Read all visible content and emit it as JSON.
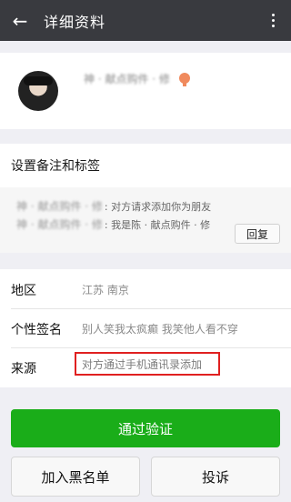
{
  "header": {
    "back_icon": "arrow-left-icon",
    "title": "详细资料",
    "more_icon": "more-vertical-icon"
  },
  "profile": {
    "name_blurred": "神 · 献点购件 · 修",
    "gender_icon": "female-gender-icon"
  },
  "remark": {
    "title": "设置备注和标签",
    "requests": [
      {
        "sender_blurred": "神 · 献点购件 · 修",
        "message": ": 对方请求添加你为朋友"
      },
      {
        "sender_blurred": "神 · 献点购件 · 修",
        "message": ": 我是陈 · 献点购件 · 修"
      }
    ],
    "reply_label": "回复"
  },
  "info": {
    "region_label": "地区",
    "region_value": "江苏  南京",
    "signature_label": "个性签名",
    "signature_value": "别人笑我太疯癫 我笑他人看不穿",
    "source_label": "来源",
    "source_value": "对方通过手机通讯录添加"
  },
  "actions": {
    "verify_label": "通过验证",
    "blacklist_label": "加入黑名单",
    "report_label": "投诉"
  },
  "colors": {
    "topbar": "#393a3f",
    "primary": "#1aad19",
    "highlight_border": "#e02020"
  }
}
